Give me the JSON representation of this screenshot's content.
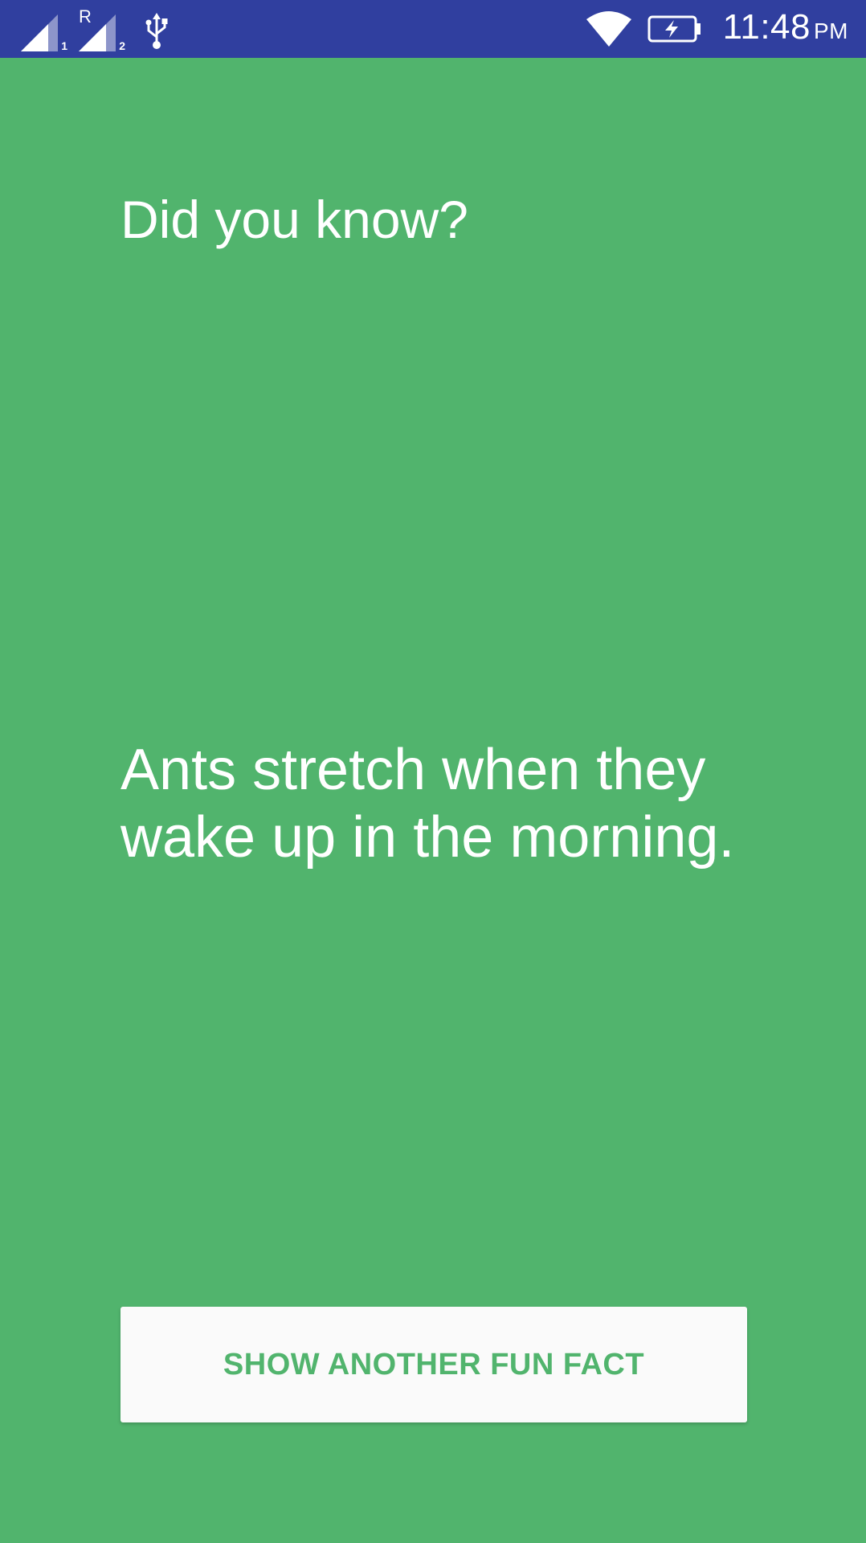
{
  "status_bar": {
    "sim1_label": "1",
    "sim2_label": "2",
    "roaming_label": "R",
    "time": "11:48",
    "ampm": "PM",
    "icons": [
      "signal-icon",
      "signal-icon",
      "usb-icon",
      "wifi-icon",
      "battery-charging-icon"
    ]
  },
  "main": {
    "heading": "Did you know?",
    "fact": "Ants stretch when they wake up in the morning.",
    "button_label": "SHOW ANOTHER FUN FACT"
  },
  "colors": {
    "background": "#51b46d",
    "status_bar": "#303f9f",
    "button_background": "#fafafa",
    "button_text": "#51b46d",
    "text": "#ffffff"
  }
}
